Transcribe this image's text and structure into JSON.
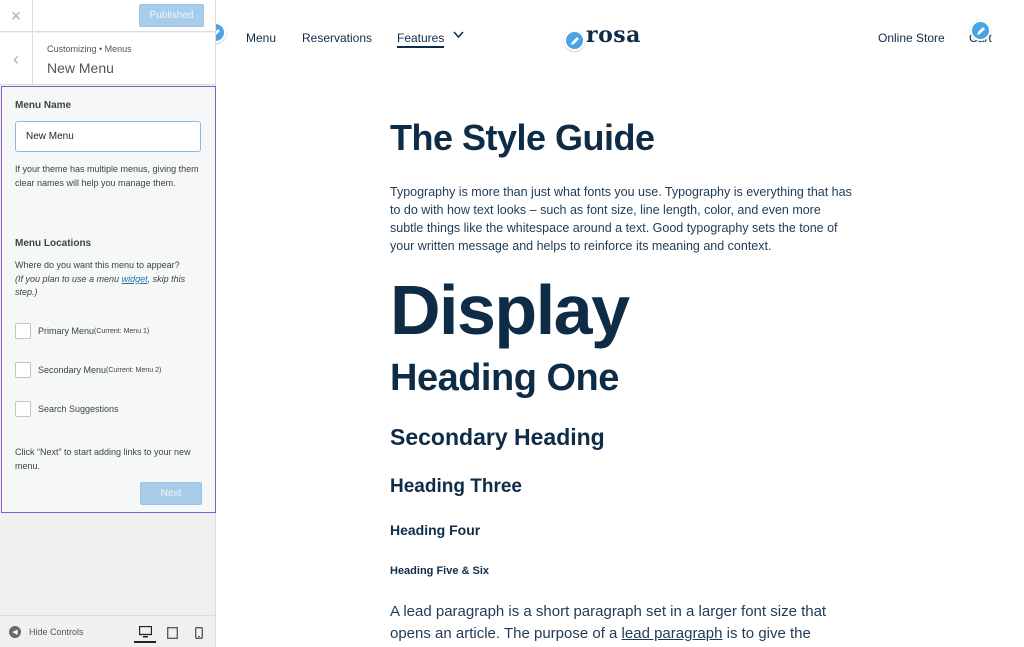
{
  "customizer": {
    "close_label": "×",
    "publish_label": "Published",
    "back_label": "‹",
    "breadcrumb": "Customizing • Menus",
    "title": "New Menu",
    "menu_name_label": "Menu Name",
    "menu_name_value": "New Menu",
    "menu_name_help": "If your theme has multiple menus, giving them clear names will help you manage them.",
    "locations_label": "Menu Locations",
    "locations_question": "Where do you want this menu to appear?",
    "locations_hint_pre": "(If you plan to use a menu ",
    "locations_hint_link": "widget",
    "locations_hint_post": ", skip this step.)",
    "locations": [
      {
        "label": "Primary Menu",
        "current": "(Current: Menu 1)",
        "checked": false
      },
      {
        "label": "Secondary Menu",
        "current": "(Current: Menu 2)",
        "checked": false
      },
      {
        "label": "Search Suggestions",
        "current": "",
        "checked": false
      }
    ],
    "next_help": "Click “Next” to start adding links to your new menu.",
    "next_label": "Next",
    "hide_controls_label": "Hide Controls",
    "devices": [
      "desktop-icon",
      "tablet-icon",
      "mobile-icon"
    ]
  },
  "preview": {
    "nav": {
      "items": [
        "Menu",
        "Reservations",
        "Features"
      ],
      "right_items": [
        "Online Store",
        "Cart"
      ]
    },
    "logo": "rosa",
    "style_guide_title": "The Style Guide",
    "intro": "Typography is more than just what fonts you use. Typography is everything that has to do with how text looks – such as font size, line length, color, and even more subtle things like the whitespace around a text. Good typography sets the tone of your written message and helps to reinforce its meaning and context.",
    "display": "Display",
    "heading_one": "Heading One",
    "secondary_heading": "Secondary Heading",
    "heading_three": "Heading Three",
    "heading_four": "Heading Four",
    "heading_five_six": "Heading Five & Six",
    "lead_pre": "A lead paragraph is a short paragraph set in a larger font size that opens an article. The purpose of a ",
    "lead_link": "lead paragraph",
    "lead_post": " is to give the"
  },
  "colors": {
    "accent": "#4aa3e6",
    "heading": "#0f2c47",
    "section_border": "#8c5bd1",
    "button_disabled": "#a7cdea"
  }
}
